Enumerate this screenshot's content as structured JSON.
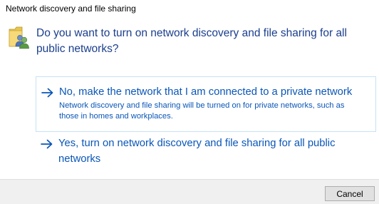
{
  "window": {
    "title": "Network discovery and file sharing"
  },
  "dialog": {
    "icon": "network-users-icon",
    "question": "Do you want to turn on network discovery and file sharing for all public networks?",
    "options": [
      {
        "icon": "arrow-right-icon",
        "label": "No, make the network that I am connected to a private network",
        "description": "Network discovery and file sharing will be turned on for private networks, such as those in homes and workplaces."
      },
      {
        "icon": "arrow-right-icon",
        "label": "Yes, turn on network discovery and file sharing for all public networks",
        "description": ""
      }
    ]
  },
  "footer": {
    "cancel_label": "Cancel"
  },
  "colors": {
    "heading": "#1b3e8c",
    "link": "#0a56b8",
    "hover_border": "#c7e2f5",
    "footer_bg": "#f0f0f0"
  }
}
